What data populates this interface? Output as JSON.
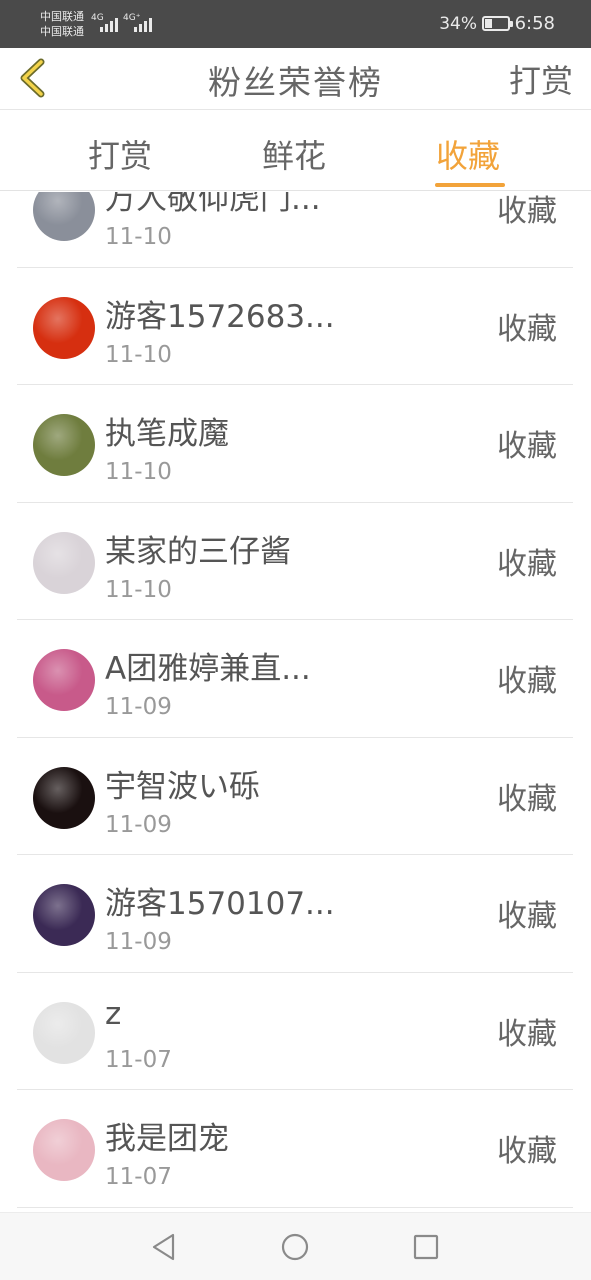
{
  "status_bar": {
    "carrier_1": "中国联通",
    "carrier_2": "中国联通",
    "signal_1": "4G",
    "signal_2": "4G⁺",
    "battery_percent": "34%",
    "battery_level": 0.34,
    "time": "6:58"
  },
  "header": {
    "title": "粉丝荣誉榜",
    "action_label": "打赏",
    "back_icon": "chevron-left-icon",
    "accent_color": "#f2a33a"
  },
  "tabs": [
    {
      "label": "打赏",
      "active": false
    },
    {
      "label": "鲜花",
      "active": false
    },
    {
      "label": "收藏",
      "active": true
    }
  ],
  "list": {
    "items": [
      {
        "name": "万人敬仰虎门...",
        "date": "11-10",
        "action": "收藏",
        "avatar_color": "#8a8f9a"
      },
      {
        "name": "游客1572683...",
        "date": "11-10",
        "action": "收藏",
        "avatar_color": "#d62f10"
      },
      {
        "name": "执笔成魔",
        "date": "11-10",
        "action": "收藏",
        "avatar_color": "#6f7d3e"
      },
      {
        "name": "某家的三仔酱",
        "date": "11-10",
        "action": "收藏",
        "avatar_color": "#d9d3d8"
      },
      {
        "name": "A团雅婷兼直...",
        "date": "11-09",
        "action": "收藏",
        "avatar_color": "#c85a8a"
      },
      {
        "name": "宇智波い砾",
        "date": "11-09",
        "action": "收藏",
        "avatar_color": "#1a1010"
      },
      {
        "name": "游客1570107...",
        "date": "11-09",
        "action": "收藏",
        "avatar_color": "#3b2a55"
      },
      {
        "name": "z",
        "date": "11-07",
        "action": "收藏",
        "avatar_color": "#e2e2e2"
      },
      {
        "name": "我是团宠",
        "date": "11-07",
        "action": "收藏",
        "avatar_color": "#e9b7c2"
      }
    ]
  },
  "nav_bar": {
    "back_icon": "triangle-back-icon",
    "home_icon": "circle-home-icon",
    "recent_icon": "square-recent-icon"
  }
}
